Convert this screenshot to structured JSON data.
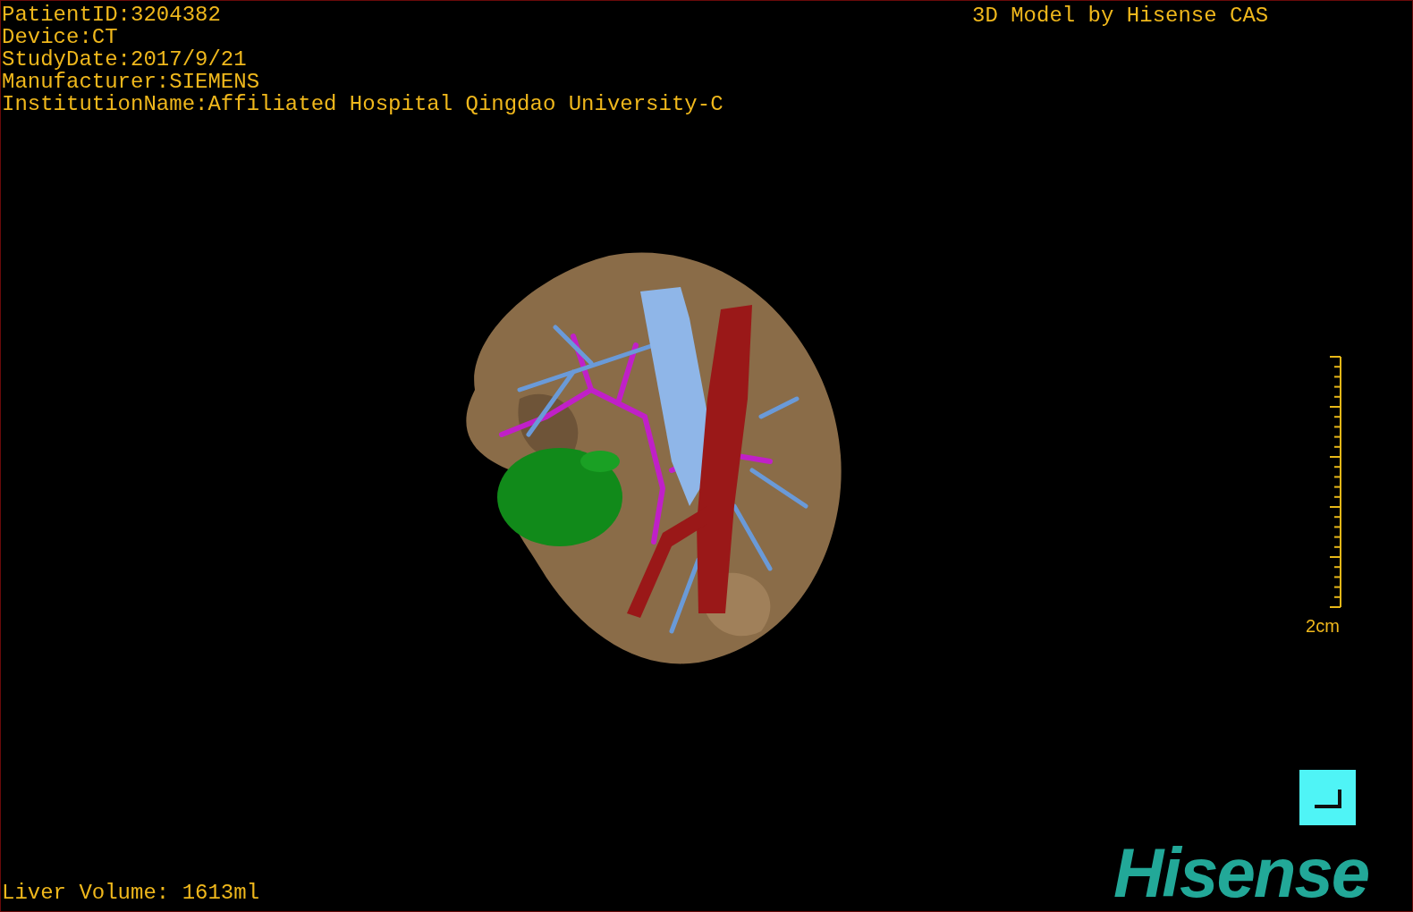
{
  "info_lines": [
    "PatientID:3204382",
    "Device:CT",
    "StudyDate:2017/9/21",
    "Manufacturer:SIEMENS",
    "InstitutionName:Affiliated Hospital Qingdao University-C"
  ],
  "title": "3D Model by Hisense CAS",
  "scale_bar": {
    "label": "2cm"
  },
  "logo": "Hisense",
  "liver_volume": "Liver Volume: 1613ml"
}
